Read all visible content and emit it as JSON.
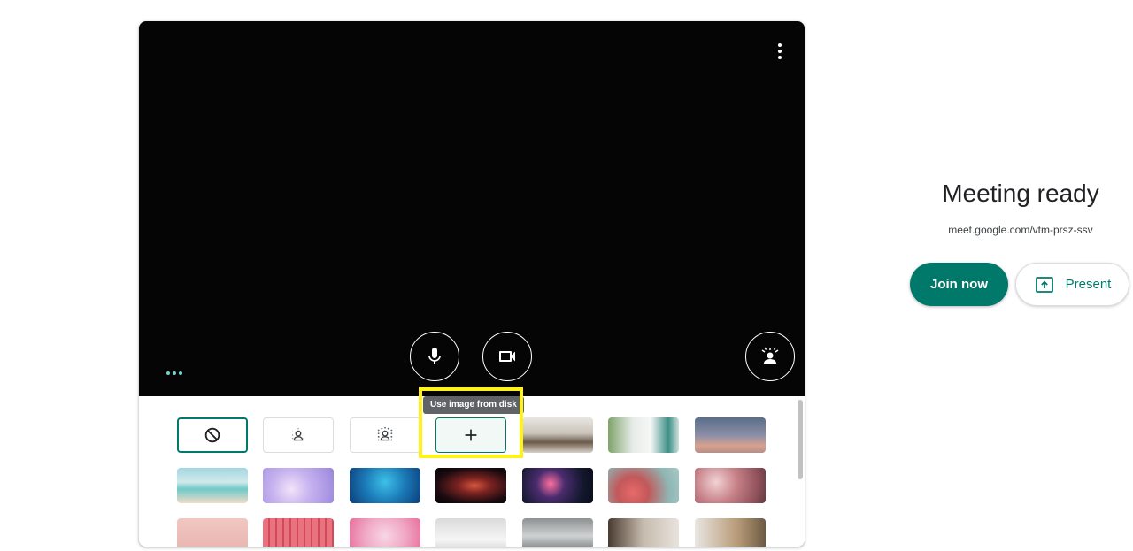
{
  "preview": {
    "more_options_icon": "more-vert-icon",
    "mic_icon": "microphone-icon",
    "camera_icon": "videocam-icon",
    "effects_icon": "visual-effects-icon",
    "dots_icon": "three-dots-icon"
  },
  "backgrounds": {
    "tooltip": "Use image from disk",
    "options": [
      {
        "name": "no-effect",
        "icon": "block-icon"
      },
      {
        "name": "slight-blur",
        "icon": "blur-person-icon"
      },
      {
        "name": "blur",
        "icon": "blur-person-icon"
      },
      {
        "name": "upload",
        "icon": "plus-icon"
      }
    ],
    "selected": "no-effect",
    "accent": "#00796b",
    "highlight_color": "#fff21a"
  },
  "meeting": {
    "title": "Meeting ready",
    "url": "meet.google.com/vtm-prsz-ssv",
    "join_label": "Join now",
    "present_label": "Present",
    "present_icon": "present-screen-icon"
  }
}
